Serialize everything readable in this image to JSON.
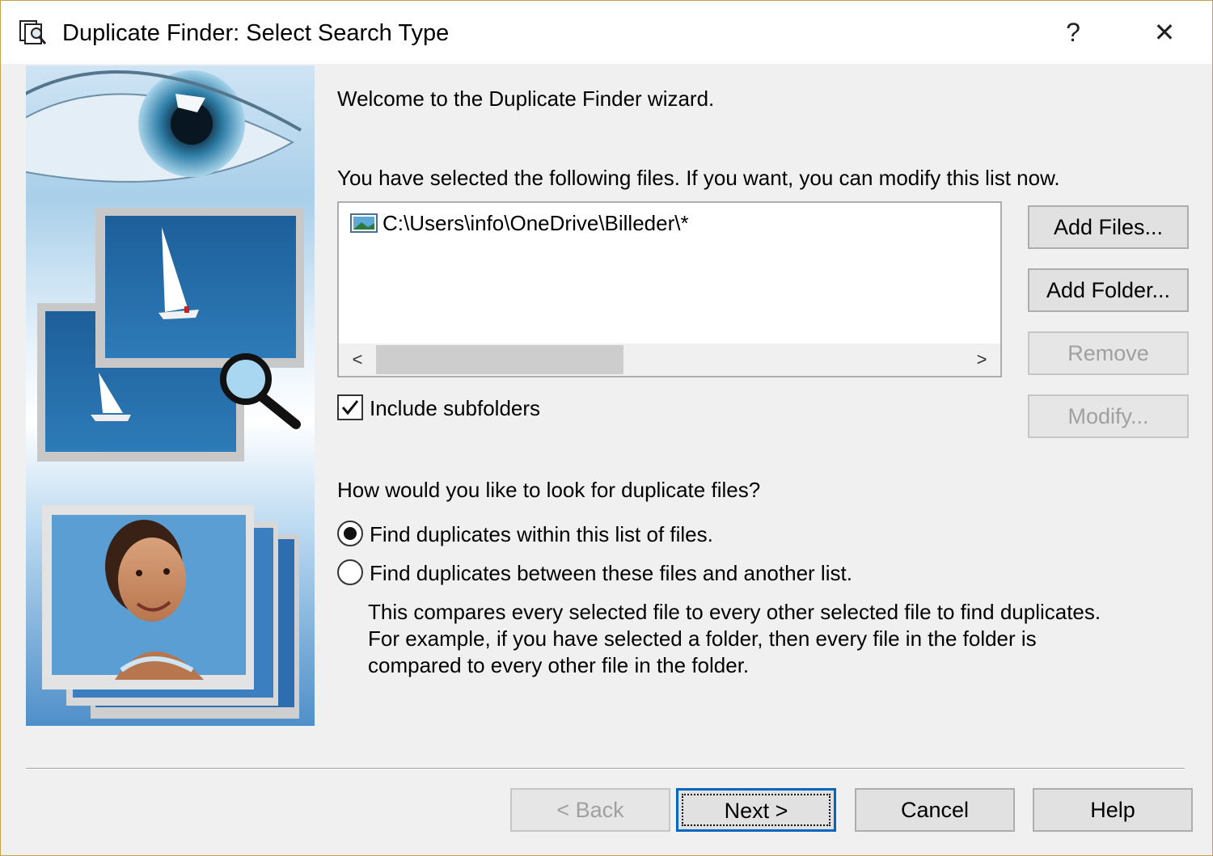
{
  "window": {
    "title": "Duplicate Finder: Select Search Type",
    "help_button": "?",
    "close_button": "✕"
  },
  "wizard": {
    "welcome": "Welcome to the Duplicate Finder wizard.",
    "files_intro": "You have selected the following files.  If you want, you can modify this list now.",
    "files": [
      {
        "path": "C:\\Users\\info\\OneDrive\\Billeder\\*",
        "icon": "image-file-icon"
      }
    ],
    "scroll_left": "<",
    "scroll_right": ">",
    "include_subfolders": {
      "label": "Include subfolders",
      "checked": true
    },
    "search_question": "How would you like to look for duplicate files?",
    "options": [
      {
        "label": "Find duplicates within this list of files.",
        "selected": true
      },
      {
        "label": "Find duplicates between these files and another list.",
        "selected": false
      }
    ],
    "description": [
      "This compares every selected file to every other selected file to find duplicates.",
      "For example, if you have selected a folder, then every file in the folder is",
      "compared to every other file in the folder."
    ]
  },
  "side_buttons": {
    "add_files": "Add Files...",
    "add_folder": "Add Folder...",
    "remove": "Remove",
    "modify": "Modify..."
  },
  "footer_buttons": {
    "back": "< Back",
    "next": "Next >",
    "cancel": "Cancel",
    "help": "Help"
  },
  "colors": {
    "accent": "#0067c0",
    "disabled_text": "#a0a0a0",
    "window_bg": "#f0f0f0"
  }
}
